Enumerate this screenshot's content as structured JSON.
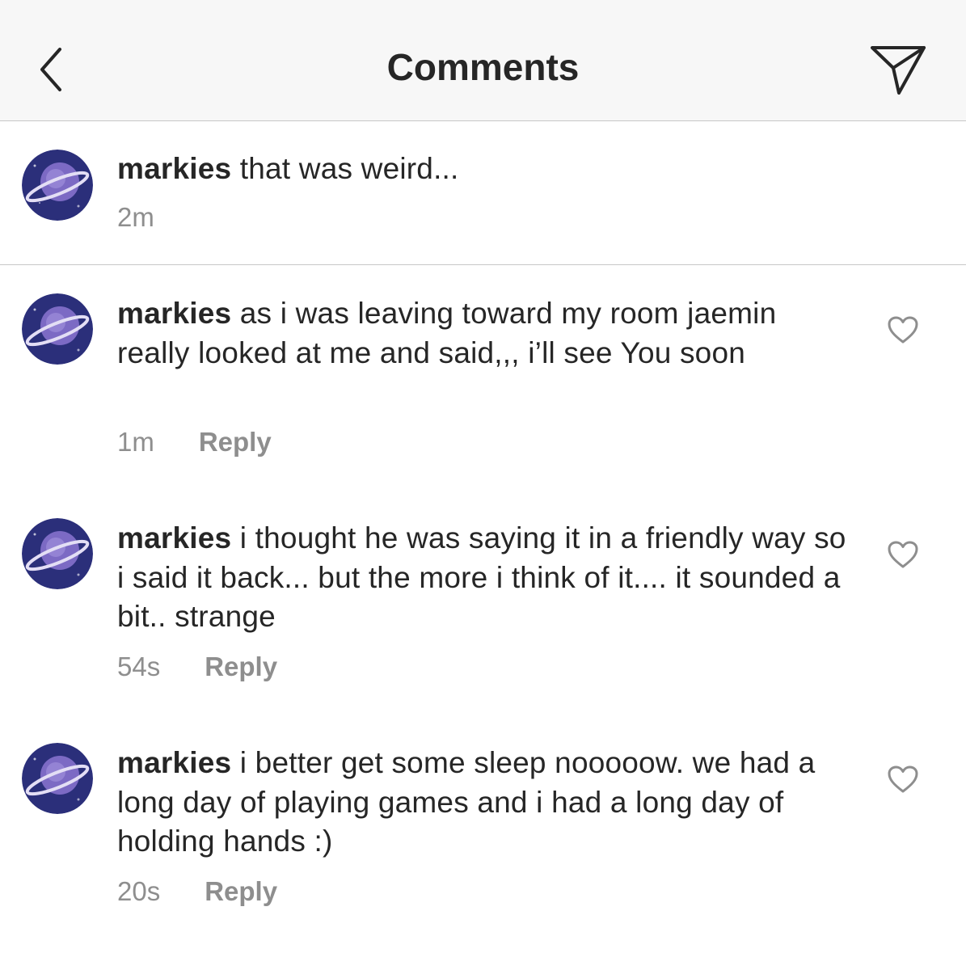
{
  "header": {
    "title": "Comments"
  },
  "caption": {
    "username": "markies",
    "text": " that was weird...",
    "time": "2m"
  },
  "comments": [
    {
      "username": "markies",
      "text": " as i was leaving toward my room jaemin really looked at me and said,,, i’ll see You soon",
      "time": "1m",
      "reply_label": "Reply"
    },
    {
      "username": "markies",
      "text": " i thought he was saying it in a friendly way so i said it back... but the more i think of it.... it sounded a bit.. strange",
      "time": "54s",
      "reply_label": "Reply"
    },
    {
      "username": "markies",
      "text": " i better get some sleep nooooow. we had a long day of playing games and i had a long day of holding hands :)",
      "time": "20s",
      "reply_label": "Reply"
    }
  ],
  "icons": {
    "back": "chevron-left-icon",
    "share": "paper-plane-icon",
    "like": "heart-outline-icon"
  },
  "colors": {
    "text": "#262626",
    "secondary": "#8e8e8e",
    "header_bg": "#f7f7f7",
    "divider": "#c7c7c7"
  }
}
